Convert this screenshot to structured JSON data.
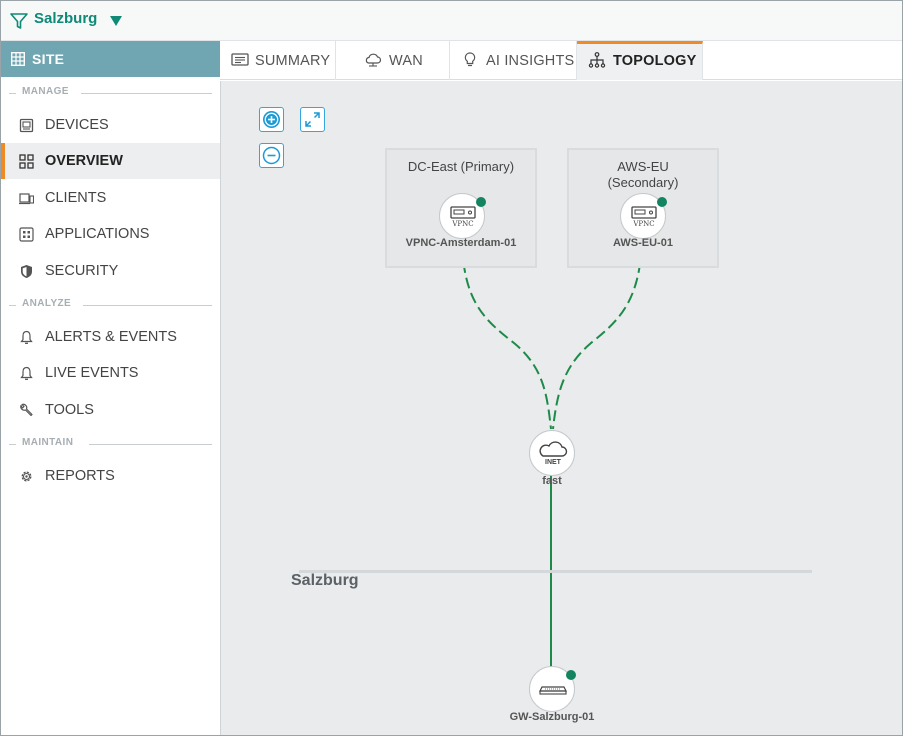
{
  "topbar": {
    "site_name": "Salzburg",
    "filter_icon": "filter-icon",
    "caret_icon": "caret-down-icon"
  },
  "sidebar": {
    "header": {
      "label": "SITE",
      "icon": "site-grid-icon"
    },
    "sections": {
      "manage": "MANAGE",
      "analyze": "ANALYZE",
      "maintain": "MAINTAIN"
    },
    "items": [
      {
        "label": "DEVICES",
        "icon": "devices-icon"
      },
      {
        "label": "OVERVIEW",
        "icon": "overview-icon",
        "active": true
      },
      {
        "label": "CLIENTS",
        "icon": "clients-icon"
      },
      {
        "label": "APPLICATIONS",
        "icon": "applications-icon"
      },
      {
        "label": "SECURITY",
        "icon": "shield-icon"
      },
      {
        "label": "ALERTS & EVENTS",
        "icon": "bell-icon"
      },
      {
        "label": "LIVE EVENTS",
        "icon": "bell-icon"
      },
      {
        "label": "TOOLS",
        "icon": "wrench-icon"
      },
      {
        "label": "REPORTS",
        "icon": "gear-icon"
      }
    ]
  },
  "tabs": [
    {
      "label": "SUMMARY",
      "icon": "summary-icon"
    },
    {
      "label": "WAN",
      "icon": "cloud-icon"
    },
    {
      "label": "AI INSIGHTS",
      "icon": "lightbulb-icon"
    },
    {
      "label": "TOPOLOGY",
      "icon": "topology-icon",
      "active": true
    }
  ],
  "topology": {
    "controls": {
      "zoom_in": "zoom-in-icon",
      "fit": "expand-icon",
      "zoom_out": "zoom-out-icon"
    },
    "hubs": [
      {
        "title": "DC-East (Primary)",
        "device": "VPNC-Amsterdam-01",
        "device_badge": "VPNC",
        "status_color": "#12845f"
      },
      {
        "title": "AWS-EU\n(Secondary)",
        "device": "AWS-EU-01",
        "device_badge": "VPNC",
        "status_color": "#12845f"
      }
    ],
    "transport": {
      "badge": "INET",
      "label": "fast"
    },
    "site": {
      "name": "Salzburg",
      "gateway": "GW-Salzburg-01",
      "status_color": "#12845f"
    },
    "link_color": "#1e8a4a"
  }
}
